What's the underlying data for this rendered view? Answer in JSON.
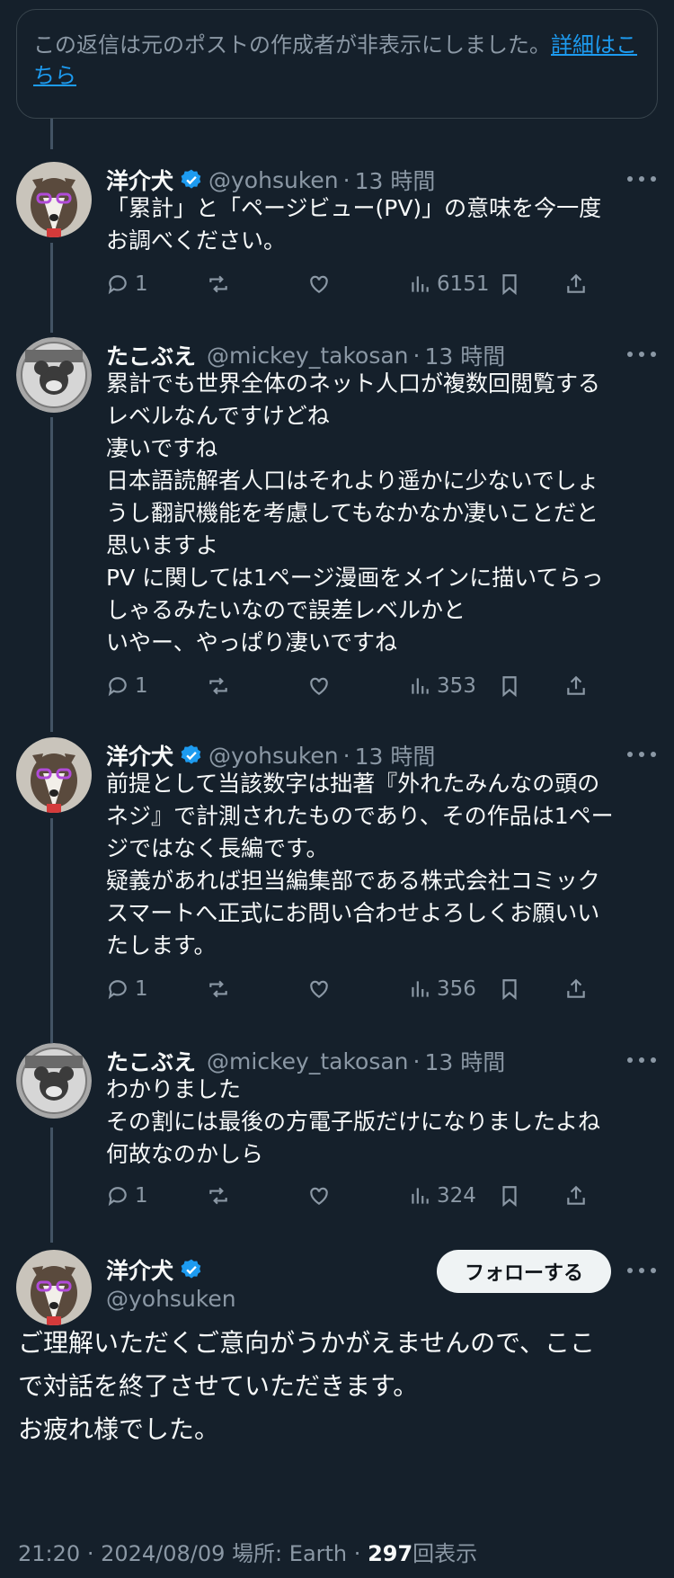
{
  "hidden_note": {
    "text": "この返信は元のポストの作成者が非表示にしました。",
    "link": "詳細はこちら"
  },
  "posts": [
    {
      "name": "洋介犬",
      "handle": "@yohsuken",
      "time": "13 時間",
      "verified": true,
      "lines": [
        "「累計」と「ページビュー(PV)」の意味を今一度",
        "お調べください。"
      ],
      "replies": "1",
      "views": "6151"
    },
    {
      "name": "たこぶえ",
      "handle": "@mickey_takosan",
      "time": "13 時間",
      "verified": false,
      "lines": [
        "累計でも世界全体のネット人口が複数回閲覧する",
        "レベルなんですけどね",
        "凄いですね",
        "日本語読解者人口はそれより遥かに少ないでしょ",
        "うし翻訳機能を考慮してもなかなか凄いことだと",
        "思いますよ",
        "PV に関しては1ページ漫画をメインに描いてらっ",
        "しゃるみたいなので誤差レベルかと",
        "いやー、やっぱり凄いですね"
      ],
      "replies": "1",
      "views": "353"
    },
    {
      "name": "洋介犬",
      "handle": "@yohsuken",
      "time": "13 時間",
      "verified": true,
      "lines": [
        "前提として当該数字は拙著『外れたみんなの頭の",
        "ネジ』で計測されたものであり、その作品は1ペー",
        "ジではなく長編です。",
        "疑義があれば担当編集部である株式会社コミック",
        "スマートへ正式にお問い合わせよろしくお願いい",
        "たします。"
      ],
      "replies": "1",
      "views": "356"
    },
    {
      "name": "たこぶえ",
      "handle": "@mickey_takosan",
      "time": "13 時間",
      "verified": false,
      "lines": [
        "わかりました",
        "その割には最後の方電子版だけになりましたよね",
        "何故なのかしら"
      ],
      "replies": "1",
      "views": "324"
    }
  ],
  "main": {
    "name": "洋介犬",
    "handle": "@yohsuken",
    "follow_label": "フォローする",
    "lines": [
      "ご理解いただくご意向がうかがえませんので、ここ",
      "で対話を終了させていただきます。",
      "お疲れ様でした。"
    ],
    "time": "21:20",
    "date": "2024/08/09",
    "place": "場所: Earth",
    "views": "297",
    "views_suffix": "回表示",
    "sep": "·"
  },
  "colors": {
    "background": "#15202b",
    "accent": "#1d9bf0",
    "muted": "#8b98a5"
  },
  "icons": [
    "reply-icon",
    "repost-icon",
    "like-icon",
    "views-icon",
    "bookmark-icon",
    "share-icon",
    "verified-badge-icon",
    "more-icon"
  ]
}
